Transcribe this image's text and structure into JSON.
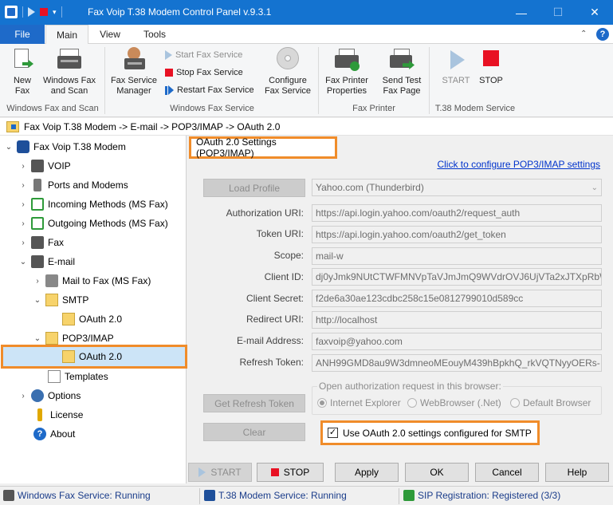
{
  "window": {
    "title": "Fax Voip T.38 Modem Control Panel v.9.3.1",
    "minimize": "—",
    "maximize": "☐",
    "close": "✕"
  },
  "ribbon": {
    "tabs": {
      "file": "File",
      "main": "Main",
      "view": "View",
      "tools": "Tools"
    },
    "help_icon_text": "?",
    "buttons": {
      "new_fax": "New Fax",
      "windows_fax_scan": "Windows Fax and Scan",
      "fax_service_manager": "Fax Service Manager",
      "start_fax_service": "Start Fax Service",
      "stop_fax_service": "Stop Fax Service",
      "restart_fax_service": "Restart Fax Service",
      "configure_fax_service": "Configure Fax Service",
      "fax_printer_properties": "Fax Printer Properties",
      "send_test_fax_page": "Send Test Fax Page",
      "start": "START",
      "stop": "STOP"
    },
    "groups": {
      "windows_fax_scan": "Windows Fax and Scan",
      "windows_fax_service": "Windows Fax Service",
      "fax_printer": "Fax Printer",
      "t38_modem_service": "T.38 Modem Service"
    }
  },
  "breadcrumb": "Fax Voip T.38 Modem -> E-mail -> POP3/IMAP -> OAuth 2.0",
  "tree": {
    "root": "Fax Voip T.38 Modem",
    "voip": "VOIP",
    "ports_modems": "Ports and Modems",
    "incoming": "Incoming Methods (MS Fax)",
    "outgoing": "Outgoing Methods (MS Fax)",
    "fax": "Fax",
    "email": "E-mail",
    "mail_to_fax": "Mail to Fax (MS Fax)",
    "smtp": "SMTP",
    "smtp_oauth": "OAuth 2.0",
    "pop3imap": "POP3/IMAP",
    "pop3_oauth": "OAuth 2.0",
    "templates": "Templates",
    "options": "Options",
    "license": "License",
    "about": "About"
  },
  "panel": {
    "title": "OAuth 2.0 Settings (POP3/IMAP)",
    "configure_link": "Click to configure POP3/IMAP settings",
    "load_profile": "Load Profile",
    "profile_value": "Yahoo.com (Thunderbird)",
    "labels": {
      "auth_uri": "Authorization URI:",
      "token_uri": "Token URI:",
      "scope": "Scope:",
      "client_id": "Client ID:",
      "client_secret": "Client Secret:",
      "redirect_uri": "Redirect URI:",
      "email": "E-mail Address:",
      "refresh_token": "Refresh Token:"
    },
    "values": {
      "auth_uri": "https://api.login.yahoo.com/oauth2/request_auth",
      "token_uri": "https://api.login.yahoo.com/oauth2/get_token",
      "scope": "mail-w",
      "client_id": "dj0yJmk9NUtCTWFMNVpTaVJmJmQ9WVdrOVJ6UjVTa2xJTXpRbWNH",
      "client_secret": "f2de6a30ae123cdbc258c15e0812799010d589cc",
      "redirect_uri": "http://localhost",
      "email": "faxvoip@yahoo.com",
      "refresh_token": "ANH99GMD8au9W3dmneoMEouyM439hBpkhQ_rkVQTNyyOERs-"
    },
    "get_refresh_token": "Get Refresh Token",
    "browser_group": "Open authorization request in this browser:",
    "browsers": {
      "ie": "Internet Explorer",
      "webbrowser": "WebBrowser (.Net)",
      "default": "Default Browser"
    },
    "clear": "Clear",
    "use_smtp_checkbox": "Use OAuth 2.0 settings configured for SMTP",
    "checked_mark": "✓"
  },
  "bottom": {
    "start": "START",
    "stop": "STOP",
    "apply": "Apply",
    "ok": "OK",
    "cancel": "Cancel",
    "help": "Help"
  },
  "status": {
    "fax_service": "Windows Fax Service: Running",
    "modem_service": "T.38 Modem Service: Running",
    "sip": "SIP Registration: Registered (3/3)"
  },
  "colors": {
    "titlebar": "#1473d0",
    "highlight": "#f08c2a",
    "selection": "#cce4f7",
    "link": "#0033cc"
  }
}
